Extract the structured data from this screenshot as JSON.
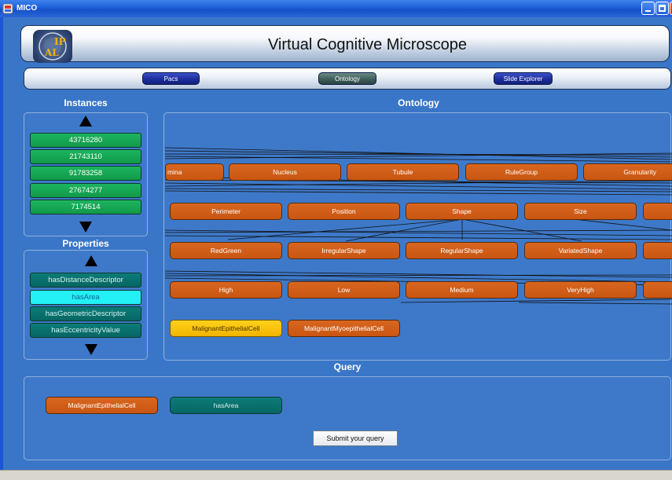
{
  "window": {
    "title": "MICO"
  },
  "header": {
    "title": "Virtual Cognitive Microscope",
    "logo_icon": "ipal-logo"
  },
  "nav": {
    "pacs": "Pacs",
    "ontology": "Ontology",
    "slide_explorer": "Slide Explorer"
  },
  "sections": {
    "instances": "Instances",
    "ontology": "Ontology",
    "properties": "Properties",
    "query": "Query"
  },
  "instances": [
    "43716280",
    "21743110",
    "91783258",
    "27674277",
    "7174514"
  ],
  "properties": [
    {
      "label": "hasDistanceDescriptor",
      "selected": false
    },
    {
      "label": "hasArea",
      "selected": true
    },
    {
      "label": "hasGeometricDescriptor",
      "selected": false
    },
    {
      "label": "hasEccentricityValue",
      "selected": false
    }
  ],
  "ontology": {
    "row1": [
      "mina",
      "Nucleus",
      "Tubule",
      "RuleGroup",
      "Granularity"
    ],
    "row2": [
      "Perimeter",
      "Position",
      "Shape",
      "Size",
      ""
    ],
    "row3": [
      "RedGreen",
      "IrregularShape",
      "RegularShape",
      "VariatedShape",
      ""
    ],
    "row4": [
      "High",
      "Low",
      "Medium",
      "VeryHigh",
      ""
    ],
    "row5": [
      "MalignantEpithelialCell",
      "MalignantMyoepithelialCell"
    ],
    "selected_node": "MalignantEpithelialCell"
  },
  "query": {
    "concept": "MalignantEpithelialCell",
    "property": "hasArea",
    "submit_label": "Submit your query"
  },
  "colors": {
    "background": "#3b73c4",
    "node": "#d2601a",
    "node_selected": "#ffcc00",
    "instance": "#17a855",
    "property": "#0a7370",
    "property_selected": "#22f0f4"
  }
}
